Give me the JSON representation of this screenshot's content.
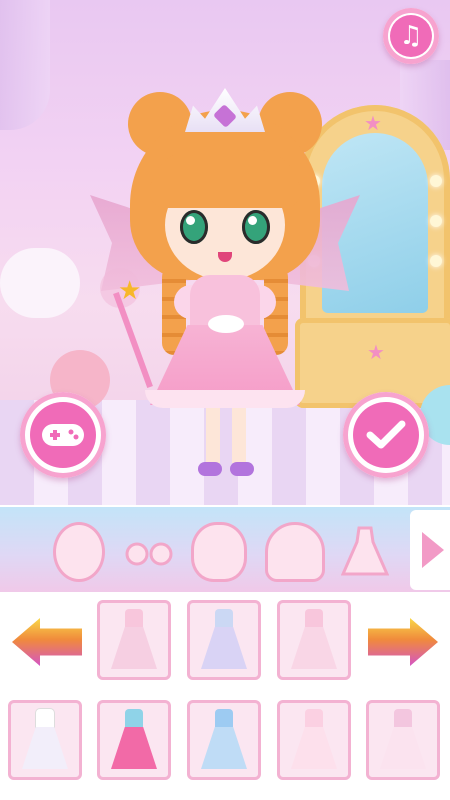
{
  "screen": {
    "title": "",
    "accent": "#f06bb8"
  },
  "top_right": {
    "icon": "music-note-icon",
    "glyph": "♫"
  },
  "action_buttons": [
    {
      "name": "game-controller-button",
      "icon": "gamepad-icon"
    },
    {
      "name": "confirm-button",
      "icon": "checkmark-icon"
    }
  ],
  "categories": [
    {
      "name": "face",
      "icon": "face-shape-icon"
    },
    {
      "name": "eyes",
      "icon": "eyes-icon"
    },
    {
      "name": "head",
      "icon": "head-icon"
    },
    {
      "name": "hair",
      "icon": "hair-icon"
    },
    {
      "name": "dress",
      "icon": "dress-icon"
    }
  ],
  "category_next": {
    "icon": "triangle-right-icon"
  },
  "item_nav": {
    "prev_icon": "arrow-left-icon",
    "next_icon": "arrow-right-icon"
  },
  "items_row1": [
    {
      "color_top": "#f8c6dc",
      "color_skirt": "#f6cfe2"
    },
    {
      "color_top": "#cbd8f4",
      "color_skirt": "#d9d3f5"
    },
    {
      "color_top": "#f8c6dc",
      "color_skirt": "#f9d6e6"
    }
  ],
  "items_row2": [
    {
      "color_top": "#ffffff",
      "color_skirt": "#f2eefa"
    },
    {
      "color_top": "#8fd3e8",
      "color_skirt": "#f26aa7"
    },
    {
      "color_top": "#9dcbf2",
      "color_skirt": "#bfdcf6"
    },
    {
      "color_top": "#fbd0e2",
      "color_skirt": "#fde0ec"
    },
    {
      "color_top": "#f3c6df",
      "color_skirt": "#fbe3ef"
    }
  ]
}
